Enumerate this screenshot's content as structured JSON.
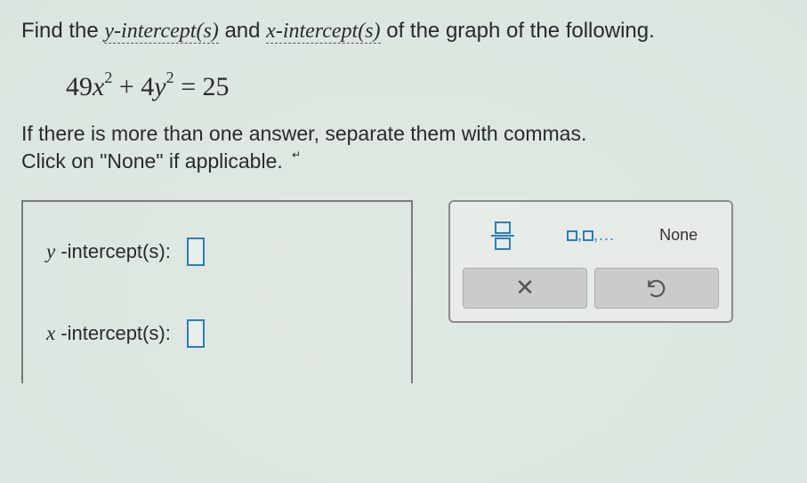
{
  "prompt": {
    "lead": "Find the ",
    "yint": "y-intercept(s)",
    "mid": " and ",
    "xint": "x-intercept(s)",
    "tail": " of the graph of the following."
  },
  "equation": {
    "a": "49",
    "var1": "x",
    "exp1": "2",
    "plus": " + ",
    "b": "4",
    "var2": "y",
    "exp2": "2",
    "eq": " = ",
    "c": "25"
  },
  "instructions": {
    "line1": "If there is more than one answer, separate them with commas.",
    "line2": "Click on \"None\" if applicable."
  },
  "answers": {
    "y": {
      "var": "y",
      "label": " -intercept(s):"
    },
    "x": {
      "var": "x",
      "label": " -intercept(s):"
    }
  },
  "palette": {
    "none": "None",
    "close": "✕",
    "list_sep": ",",
    "list_dots": ",..."
  },
  "chart_data": {
    "type": "table",
    "title": "Intercepts of 49x^2 + 4y^2 = 25",
    "equation": "49x^2 + 4y^2 = 25",
    "unknowns": [
      "y-intercept(s)",
      "x-intercept(s)"
    ],
    "tools": [
      "fraction",
      "comma-separated list",
      "None",
      "clear",
      "undo"
    ]
  }
}
